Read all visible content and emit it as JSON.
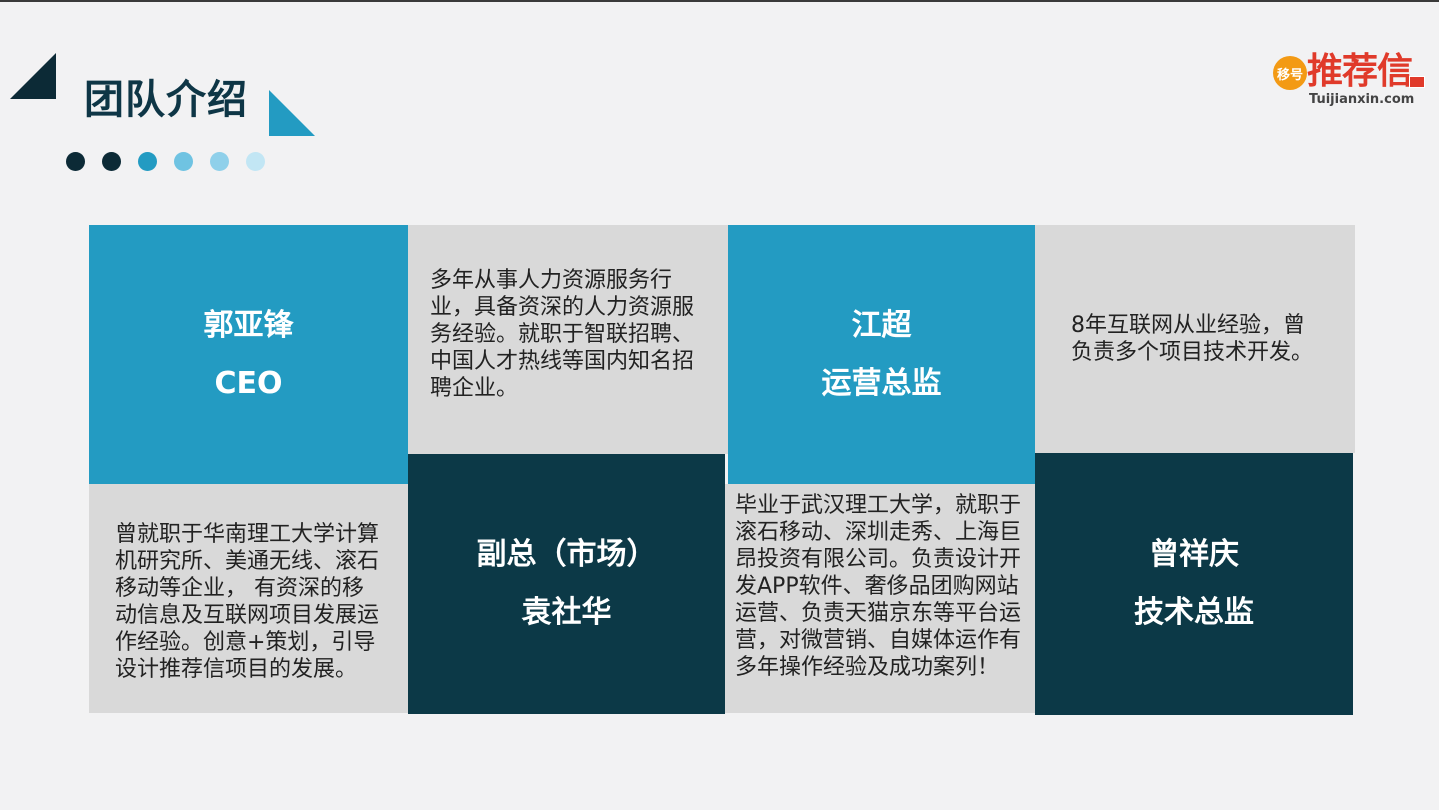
{
  "slide": {
    "title": "团队介绍",
    "dot_colors": [
      "#0c2a36",
      "#0c2a36",
      "#239bc2",
      "#6fc3e2",
      "#8fd0ea",
      "#c2e6f4"
    ]
  },
  "logo": {
    "badge": "移号",
    "brand": "推荐信",
    "domain": "Tuijianxin.com"
  },
  "colors": {
    "blue": "#239bc2",
    "navy": "#0c3947",
    "gray": "#d9d9d9",
    "title": "#0e3646"
  },
  "members": [
    {
      "name": "郭亚锋",
      "role": "CEO",
      "desc": "曾就职于华南理工大学计算机研究所、美通无线、滚石移动等企业， 有资深的移动信息及互联网项目发展运作经验。创意+策划，引导设计推荐信项目的发展。"
    },
    {
      "name": "副总（市场）",
      "role": "袁社华",
      "desc": "多年从事人力资源服务行业，具备资深的人力资源服务经验。就职于智联招聘、中国人才热线等国内知名招聘企业。"
    },
    {
      "name": "江超",
      "role": "运营总监",
      "desc": "毕业于武汉理工大学，就职于滚石移动、深圳走秀、上海巨昂投资有限公司。负责设计开发APP软件、奢侈品团购网站运营、负责天猫京东等平台运营，对微营销、自媒体运作有多年操作经验及成功案列！"
    },
    {
      "name": "曾祥庆",
      "role": "技术总监",
      "desc": "8年互联网从业经验，曾负责多个项目技术开发。"
    }
  ]
}
